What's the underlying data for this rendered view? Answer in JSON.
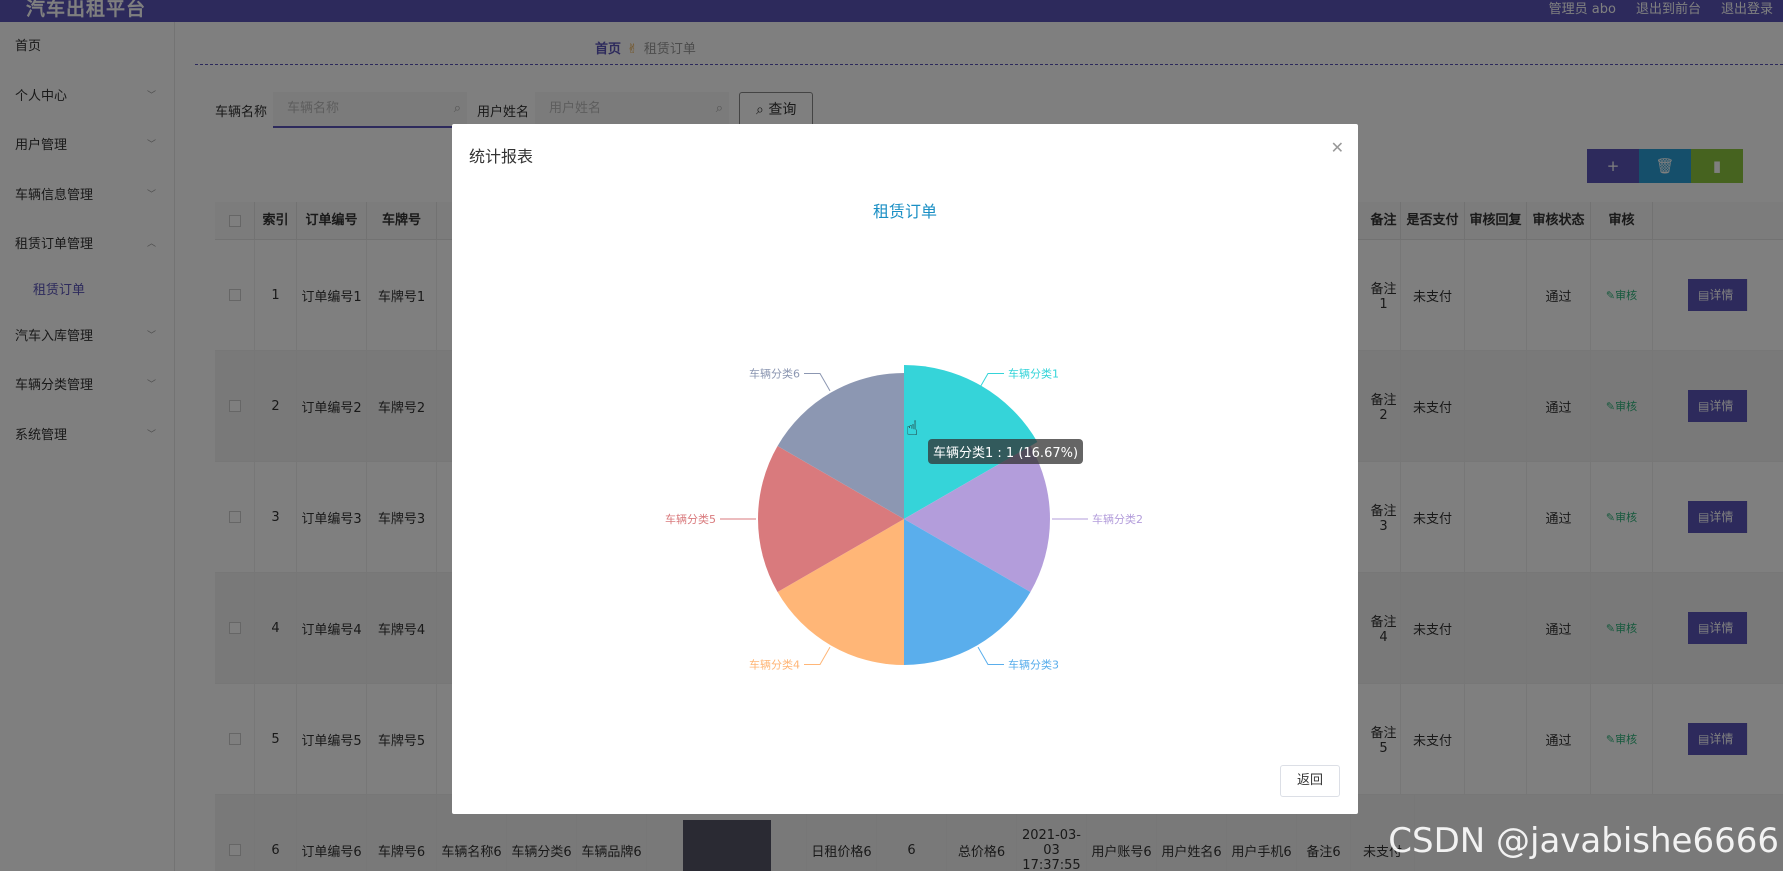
{
  "topbar": {
    "brand": "汽车出租平台",
    "admin_label": "管理员 abo",
    "front_label": "退出到前台",
    "logout_label": "退出登录"
  },
  "sidebar": {
    "items": [
      {
        "label": "首页"
      },
      {
        "label": "个人中心"
      },
      {
        "label": "用户管理"
      },
      {
        "label": "车辆信息管理"
      },
      {
        "label": "租赁订单管理"
      },
      {
        "label": "租赁订单"
      },
      {
        "label": "汽车入库管理"
      },
      {
        "label": "车辆分类管理"
      },
      {
        "label": "系统管理"
      }
    ]
  },
  "breadcrumb": {
    "home": "首页",
    "current": "租赁订单"
  },
  "search": {
    "vehicle_label": "车辆名称",
    "vehicle_placeholder": "车辆名称",
    "user_label": "用户姓名",
    "user_placeholder": "用户姓名",
    "query_label": "查询"
  },
  "table": {
    "headers": [
      "索引",
      "订单编号",
      "车牌号",
      "备注",
      "是否支付",
      "审核回复",
      "审核状态",
      "审核"
    ],
    "rows": [
      {
        "idx": "1",
        "order": "订单编号1",
        "plate": "车牌号1",
        "note": "备注1",
        "paid": "未支付",
        "status": "通过",
        "audit": "审核",
        "detail": "详情"
      },
      {
        "idx": "2",
        "order": "订单编号2",
        "plate": "车牌号2",
        "note": "备注2",
        "paid": "未支付",
        "status": "通过",
        "audit": "审核",
        "detail": "详情"
      },
      {
        "idx": "3",
        "order": "订单编号3",
        "plate": "车牌号3",
        "note": "备注3",
        "paid": "未支付",
        "status": "通过",
        "audit": "审核",
        "detail": "详情"
      },
      {
        "idx": "4",
        "order": "订单编号4",
        "plate": "车牌号4",
        "note": "备注4",
        "paid": "未支付",
        "status": "通过",
        "audit": "审核",
        "detail": "详情"
      },
      {
        "idx": "5",
        "order": "订单编号5",
        "plate": "车牌号5",
        "note": "备注5",
        "paid": "未支付",
        "status": "通过",
        "audit": "审核",
        "detail": "详情"
      }
    ],
    "row6": {
      "idx": "6",
      "order": "订单编号6",
      "plate": "车牌号6",
      "vname": "车辆名称6",
      "vcat": "车辆分类6",
      "brand": "车辆品牌6",
      "daily": "日租价格6",
      "days": "6",
      "total": "总价格6",
      "date": "2021-03-03 17:37:55",
      "account": "用户账号6",
      "uname": "用户姓名6",
      "phone": "用户手机6",
      "note": "备注6",
      "paid": "未支付"
    }
  },
  "dialog": {
    "title": "统计报表",
    "back_label": "返回",
    "tooltip": "车辆分类1 : 1 (16.67%)"
  },
  "chart_data": {
    "type": "pie",
    "title": "租赁订单",
    "categories": [
      "车辆分类1",
      "车辆分类2",
      "车辆分类3",
      "车辆分类4",
      "车辆分类5",
      "车辆分类6"
    ],
    "values": [
      1,
      1,
      1,
      1,
      1,
      1
    ],
    "colors": [
      "#35d4d9",
      "#b39ddb",
      "#5aaeec",
      "#ffb677",
      "#d97a7d",
      "#8c97b2"
    ],
    "highlighted": "车辆分类1"
  },
  "watermark": "CSDN @javabishe6666"
}
